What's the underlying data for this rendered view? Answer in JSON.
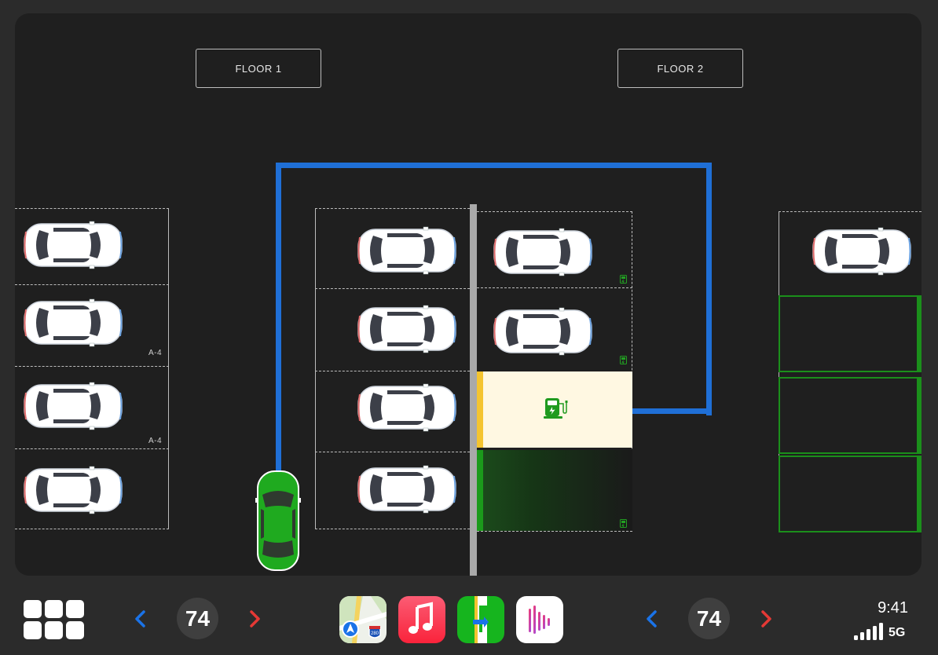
{
  "floors": {
    "floor1": "FLOOR 1",
    "floor2": "FLOOR 2"
  },
  "slot_labels": [
    "A-4",
    "A-4"
  ],
  "dock": {
    "left_temp": "74",
    "right_temp": "74",
    "time": "9:41",
    "network": "5G",
    "apps": [
      "maps-app",
      "music-app",
      "parking-app",
      "podcasts-app"
    ]
  },
  "colors": {
    "route": "#1f6fd6",
    "user_car": "#1faa1f",
    "available_slot": "#1b8f1b",
    "selected_slot": "#fff8e2",
    "selected_marker": "#f4c430",
    "chevron_left": "#1a73e8",
    "chevron_right": "#e53935"
  }
}
